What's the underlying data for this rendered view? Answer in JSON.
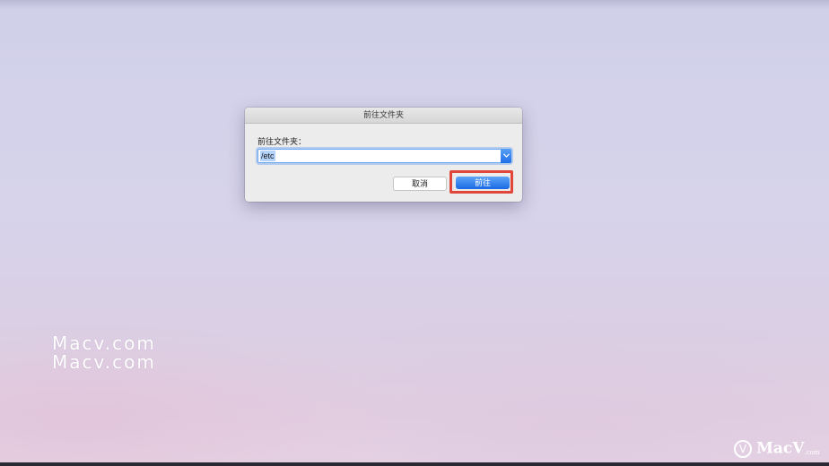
{
  "dialog": {
    "title": "前往文件夹",
    "field_label": "前往文件夹：",
    "path_value": "/etc",
    "cancel_label": "取消",
    "go_label": "前往",
    "dropdown_icon": "chevron-down-icon"
  },
  "watermark": {
    "line1": "Macv.com",
    "line2": "Macv.com"
  },
  "logo": {
    "mark": "V",
    "text": "MacV",
    "suffix": ".com"
  },
  "colors": {
    "accent_blue": "#1a6ae4",
    "highlight_red": "#e0463a"
  }
}
